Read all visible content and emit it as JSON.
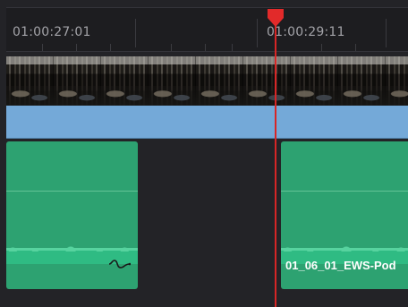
{
  "ruler": {
    "timecode_left": "01:00:27:01",
    "timecode_right": "01:00:29:11"
  },
  "clips": {
    "right_audio_name": "01_06_01_EWS-Pod"
  },
  "icons": {
    "playhead": "playhead-icon",
    "fade": "audio-fade-icon"
  },
  "colors": {
    "background": "#232327",
    "ruler": "#1d1d20",
    "video_bar": "#74a9d8",
    "audio_clip": "#2da271",
    "playhead": "#d72626"
  }
}
